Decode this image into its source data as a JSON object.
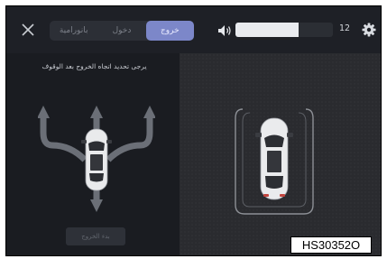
{
  "header": {
    "tabs": [
      {
        "label": "بانورامية",
        "active": false
      },
      {
        "label": "دخول",
        "active": false
      },
      {
        "label": "خروج",
        "active": true
      }
    ],
    "volume": {
      "level": 0.65,
      "value_text": "12"
    }
  },
  "left_panel": {
    "instruction": "يرجى تحديد اتجاه الخروج بعد الوقوف",
    "exit_button_label": "بدء الخروج"
  },
  "figure_code": "HS30352O",
  "colors": {
    "accent": "#7c87c9",
    "background": "#1b1d22"
  }
}
